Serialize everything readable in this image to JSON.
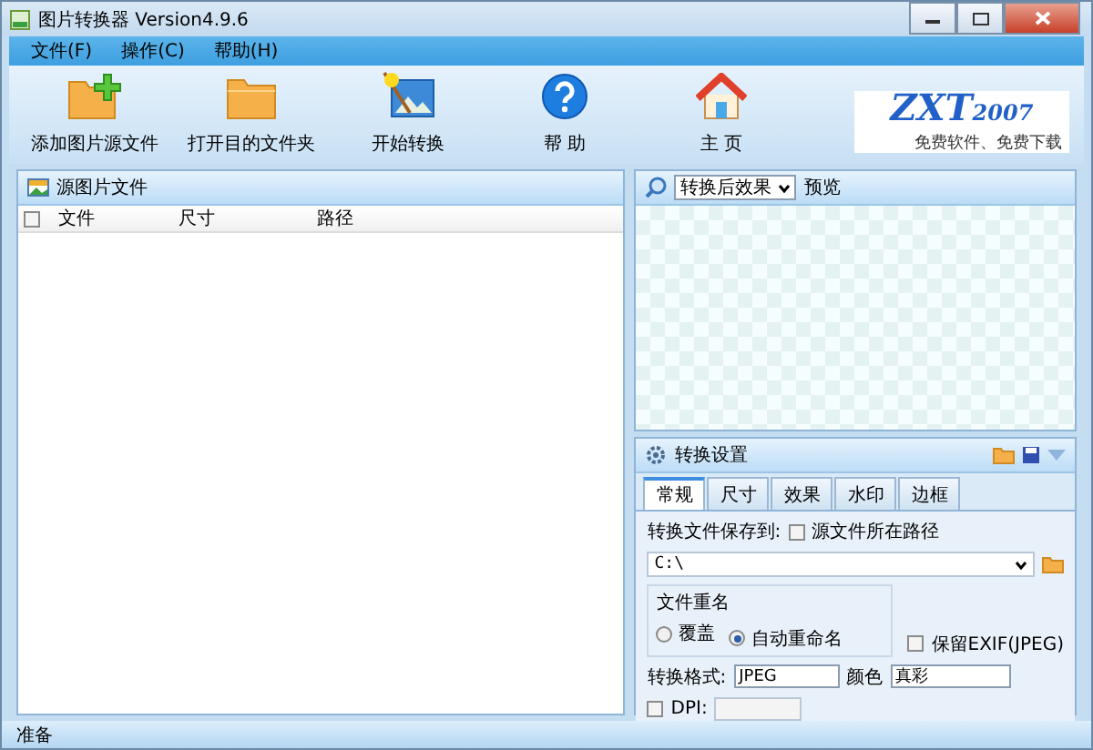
{
  "window": {
    "title": "图片转换器 Version4.9.6"
  },
  "menu": [
    "文件(F)",
    "操作(C)",
    "帮助(H)"
  ],
  "toolbar": [
    {
      "kind": "add-folder",
      "label": "添加图片源文件"
    },
    {
      "kind": "folder",
      "label": "打开目的文件夹"
    },
    {
      "kind": "wand",
      "label": "开始转换"
    },
    {
      "kind": "help",
      "label": "帮 助"
    },
    {
      "kind": "home",
      "label": "主 页"
    }
  ],
  "logo": {
    "title": "ZXT",
    "year": "2007",
    "slogan": "免费软件、免费下载"
  },
  "source_panel": {
    "title": "源图片文件",
    "select_all_checked": false,
    "columns": [
      "文件",
      "尺寸",
      "路径"
    ]
  },
  "preview_panel": {
    "mode": "转换后效果",
    "label": "预览"
  },
  "settings_panel": {
    "title": "转换设置",
    "tabs": [
      {
        "label": "常规",
        "selected": true
      },
      {
        "label": "尺寸",
        "selected": false
      },
      {
        "label": "效果",
        "selected": false
      },
      {
        "label": "水印",
        "selected": false
      },
      {
        "label": "边框",
        "selected": false
      }
    ],
    "save_to_label": "转换文件保存到:",
    "source_path": {
      "label": "源文件所在路径",
      "checked": false
    },
    "path": "C:\\",
    "rename": {
      "title": "文件重名",
      "options": [
        {
          "label": "覆盖",
          "selected": false
        },
        {
          "label": "自动重命名",
          "selected": true
        }
      ]
    },
    "keep_exif": {
      "label": "保留EXIF(JPEG)",
      "checked": false
    },
    "format_label": "转换格式:",
    "format": "JPEG",
    "color_label": "颜色",
    "color_mode": "真彩",
    "dpi": {
      "label": "DPI:",
      "checked": false
    }
  },
  "status_bar": "准备"
}
